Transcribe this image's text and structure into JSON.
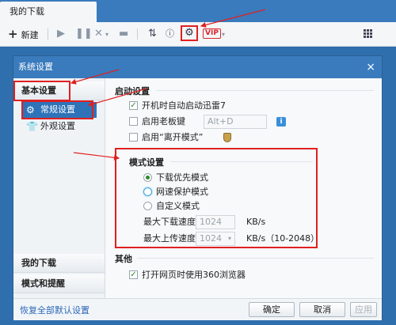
{
  "app": {
    "tab_title": "我的下载"
  },
  "toolbar": {
    "new_label": "新建",
    "vip_label": "VIP",
    "icons": [
      "play-icon",
      "pause-icon",
      "delete-icon",
      "folder-icon",
      "sort-icon",
      "info-icon",
      "gear-icon",
      "vip-icon",
      "grid-icon"
    ]
  },
  "dialog": {
    "title": "系统设置",
    "close": "×"
  },
  "sidebar": {
    "group_basic": "基本设置",
    "item_general": "常规设置",
    "item_appearance": "外观设置",
    "group_downloads": "我的下载",
    "group_modes": "模式和提醒"
  },
  "startup": {
    "title": "启动设置",
    "auto_start": {
      "label": "开机时自动启动迅雷7",
      "checked": true
    },
    "boss_key": {
      "label": "启用老板键",
      "checked": false,
      "value": "Alt+D"
    },
    "away_mode": {
      "label": "启用“离开模式”",
      "checked": false
    }
  },
  "mode": {
    "title": "模式设置",
    "options": [
      {
        "label": "下载优先模式",
        "selected": true
      },
      {
        "label": "网速保护模式",
        "selected": false
      },
      {
        "label": "自定义模式",
        "selected": false
      }
    ],
    "max_download_label": "最大下载速度",
    "max_download_value": "1024",
    "max_download_unit": "KB/s",
    "max_upload_label": "最大上传速度",
    "max_upload_value": "1024",
    "max_upload_unit": "KB/s（10-2048）"
  },
  "other": {
    "title": "其他",
    "open_360": {
      "label": "打开网页时使用360浏览器",
      "checked": true
    }
  },
  "footer": {
    "restore_label": "恢复全部默认设置",
    "ok_label": "确定",
    "cancel_label": "取消",
    "apply_label": "应用"
  },
  "colors": {
    "title_bar": "#3a7bbd",
    "annotation_red": "#e02020",
    "active_item": "#2e73b8"
  }
}
